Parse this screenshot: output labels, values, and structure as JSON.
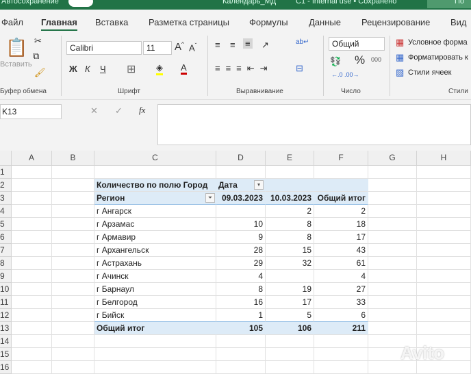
{
  "title": {
    "autosave": "Автосохранение",
    "file": "Календарь_МД",
    "label": "C1 - Internal use • Сохранено",
    "search": "По"
  },
  "tabs": [
    "Файл",
    "Главная",
    "Вставка",
    "Разметка страницы",
    "Формулы",
    "Данные",
    "Рецензирование",
    "Вид"
  ],
  "ribbon": {
    "paste": "Вставить",
    "font": "Calibri",
    "size": "11",
    "bold": "Ж",
    "italic": "К",
    "underline": "Ч",
    "number_format": "Общий",
    "percent": "%",
    "thousands": "000",
    "cond_format": "Условное форма",
    "format_table": "Форматировать к",
    "cell_styles": "Стили ячеек",
    "groups": {
      "clipboard": "Буфер обмена",
      "font": "Шрифт",
      "alignment": "Выравнивание",
      "number": "Число",
      "styles": "Стили"
    }
  },
  "formula": {
    "namebox": "K13",
    "fx": "fx",
    "cancel": "✕",
    "confirm": "✓"
  },
  "sheet": {
    "columns": [
      "A",
      "B",
      "C",
      "D",
      "E",
      "F",
      "G",
      "H"
    ],
    "rows": [
      "1",
      "2",
      "3",
      "4",
      "5",
      "6",
      "7",
      "8",
      "9",
      "10",
      "11",
      "12",
      "13",
      "14",
      "15",
      "16"
    ],
    "pivot": {
      "value_label": "Количество по полю Город",
      "col_field": "Дата",
      "row_field": "Регион",
      "headers": [
        "09.03.2023",
        "10.03.2023",
        "Общий итог"
      ],
      "data": [
        [
          "г Ангарск",
          "",
          "2",
          "2"
        ],
        [
          "г Арзамас",
          "10",
          "8",
          "18"
        ],
        [
          "г Армавир",
          "9",
          "8",
          "17"
        ],
        [
          "г Архангельск",
          "28",
          "15",
          "43"
        ],
        [
          "г Астрахань",
          "29",
          "32",
          "61"
        ],
        [
          "г Ачинск",
          "4",
          "",
          "4"
        ],
        [
          "г Барнаул",
          "8",
          "19",
          "27"
        ],
        [
          "г Белгород",
          "16",
          "17",
          "33"
        ],
        [
          "г Бийск",
          "1",
          "5",
          "6"
        ]
      ],
      "total": [
        "Общий итог",
        "105",
        "106",
        "211"
      ]
    }
  },
  "watermark": "Avito"
}
